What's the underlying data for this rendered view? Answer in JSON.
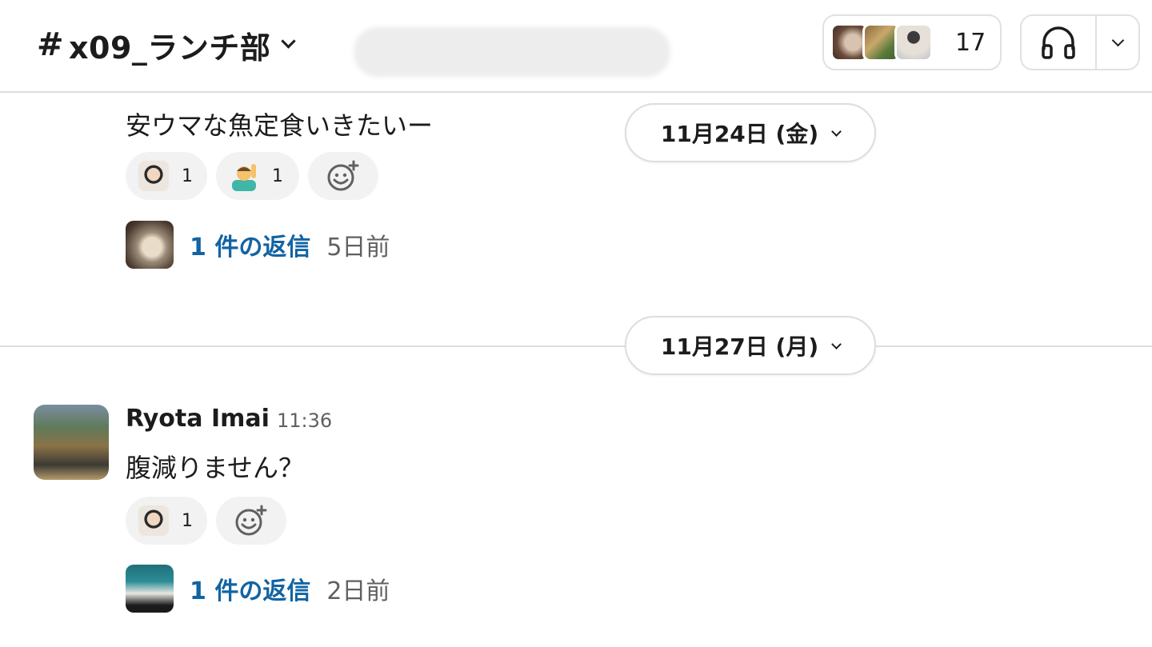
{
  "header": {
    "hash": "#",
    "channel": "x09_ランチ部",
    "member_count": "17"
  },
  "messages": [
    {
      "text": "安ウマな魚定食いきたいー",
      "reactions": [
        {
          "emoji": "person-avatar",
          "count": "1"
        },
        {
          "emoji": "person-raising-hand",
          "count": "1"
        }
      ],
      "thread": {
        "replies": "1 件の返信",
        "time": "5日前"
      }
    },
    {
      "author": "Ryota Imai",
      "time": "11:36",
      "text": "腹減りません？",
      "reactions": [
        {
          "emoji": "person-avatar",
          "count": "1"
        }
      ],
      "thread": {
        "replies": "1 件の返信",
        "time": "2日前"
      }
    }
  ],
  "dividers": [
    {
      "label": "11月24日 (金)"
    },
    {
      "label": "11月27日 (月)"
    }
  ],
  "icons": {
    "add_reaction": "add-reaction-icon",
    "huddle": "headphones-icon",
    "dropdown": "chevron-down-icon"
  },
  "colors": {
    "link": "#1264a3",
    "muted": "#616061",
    "reaction_bg": "#f2f2f2",
    "border": "#dddddd"
  }
}
